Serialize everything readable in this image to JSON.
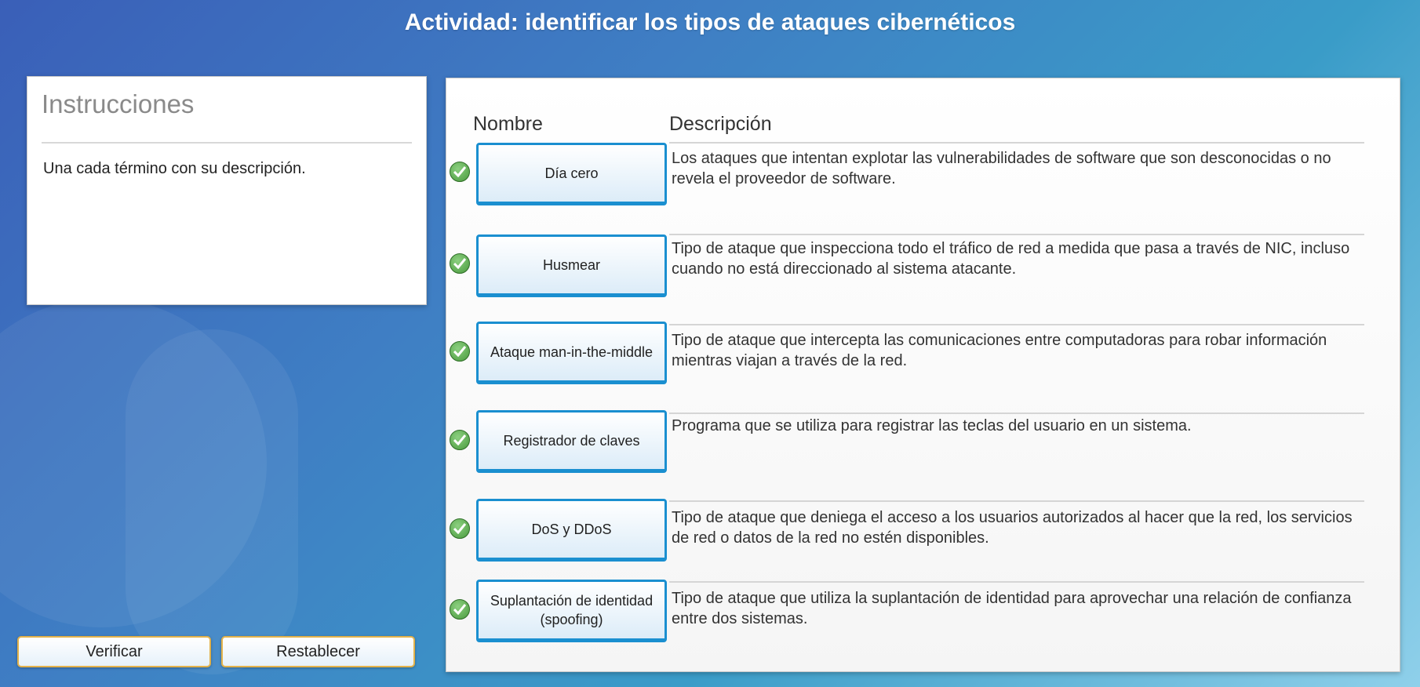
{
  "title": "Actividad: identificar los tipos de ataques cibernéticos",
  "instructions": {
    "heading": "Instrucciones",
    "text": "Una cada término con su descripción."
  },
  "buttons": {
    "verify": "Verificar",
    "reset": "Restablecer"
  },
  "table": {
    "col_name": "Nombre",
    "col_desc": "Descripción",
    "rows": [
      {
        "term": "Día cero",
        "description": "Los ataques que intentan explotar las vulnerabilidades de software que son desconocidas o no revela el proveedor de software.",
        "status": "correct"
      },
      {
        "term": "Husmear",
        "description": "Tipo de ataque que inspecciona todo el tráfico de red a medida que pasa a través de NIC, incluso cuando no está direccionado al sistema atacante.",
        "status": "correct"
      },
      {
        "term": "Ataque man-in-the-middle",
        "description": "Tipo de ataque que intercepta las comunicaciones entre computadoras para robar información mientras viajan a través de la red.",
        "status": "correct"
      },
      {
        "term": "Registrador de claves",
        "description": "Programa que se utiliza para registrar las teclas del usuario en un sistema.",
        "status": "correct"
      },
      {
        "term": "DoS y DDoS",
        "description": "Tipo de ataque que deniega el acceso a los usuarios autorizados al hacer que la red, los servicios de red o datos de la red no estén disponibles.",
        "status": "correct"
      },
      {
        "term": "Suplantación de identidad (spoofing)",
        "description": "Tipo de ataque que utiliza la suplantación de identidad para aprovechar una relación de confianza entre dos sistemas.",
        "status": "correct"
      }
    ]
  },
  "icons": {
    "status_correct": "check-circle-icon"
  },
  "colors": {
    "accent": "#1a8fd0",
    "correct": "#4a9a3e",
    "button_border": "#e3b24a"
  }
}
